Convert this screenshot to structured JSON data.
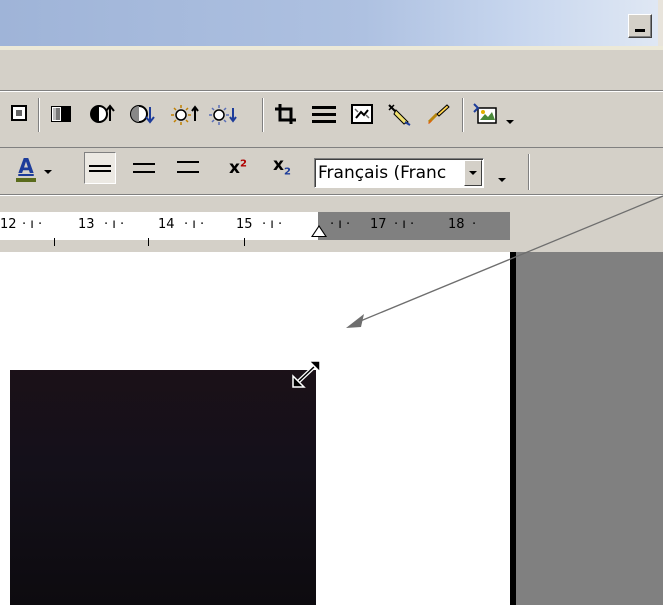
{
  "titlebar": {
    "minimize_label": "_"
  },
  "toolbar_picture": {
    "icons": [
      "picture-cut-icon",
      "color-mode-icon",
      "more-contrast-icon",
      "less-contrast-icon",
      "more-brightness-icon",
      "less-brightness-icon",
      "crop-icon",
      "line-style-icon",
      "compress-pictures-icon",
      "set-transparent-color-icon",
      "format-picture-icon",
      "insert-picture-icon"
    ]
  },
  "toolbar_format": {
    "font_color_letter": "A",
    "superscript_base": "x",
    "superscript_mark": "2",
    "subscript_base": "x",
    "subscript_mark": "2",
    "language": "Français (Franc"
  },
  "ruler": {
    "labels": [
      "12",
      "13",
      "14",
      "15",
      "17",
      "18"
    ]
  },
  "colors": {
    "face": "#d4d0c8",
    "titlebar_gradient_start": "#9fb4d8",
    "document_gray": "#808080",
    "image_dark": "#14101a"
  }
}
